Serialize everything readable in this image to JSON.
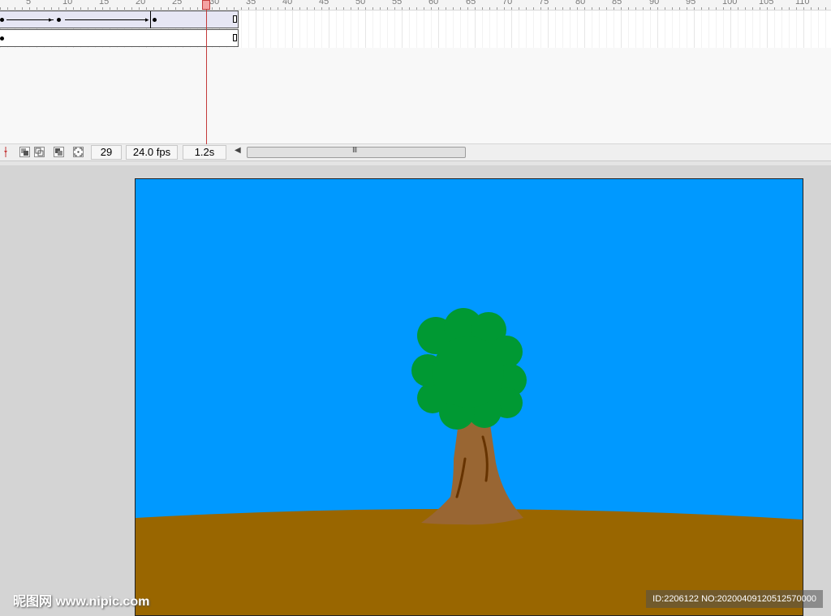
{
  "timeline": {
    "ruler_labels": [
      "5",
      "10",
      "15",
      "20",
      "25",
      "30",
      "35",
      "40",
      "45",
      "50",
      "55",
      "60",
      "65",
      "70",
      "75",
      "80",
      "85",
      "90",
      "95",
      "100",
      "105",
      "110"
    ],
    "current_frame_label": "30"
  },
  "status_bar": {
    "current_frame": "29",
    "frame_rate": "24.0 fps",
    "elapsed_time": "1.2s",
    "scroll_grip": "III"
  },
  "watermark": {
    "left": "昵图网 www.nipic.com",
    "right": "ID:2206122 NO:20200409120512570000"
  },
  "colors": {
    "sky": "#0099ff",
    "ground": "#996600",
    "foliage": "#009933",
    "trunk": "#996633",
    "playhead": "#c43b3b"
  },
  "icons": [
    "onion-skin-icon",
    "onion-skin-outline-icon",
    "edit-multiple-frames-icon",
    "modify-onion-markers-icon",
    "center-frame-icon"
  ]
}
